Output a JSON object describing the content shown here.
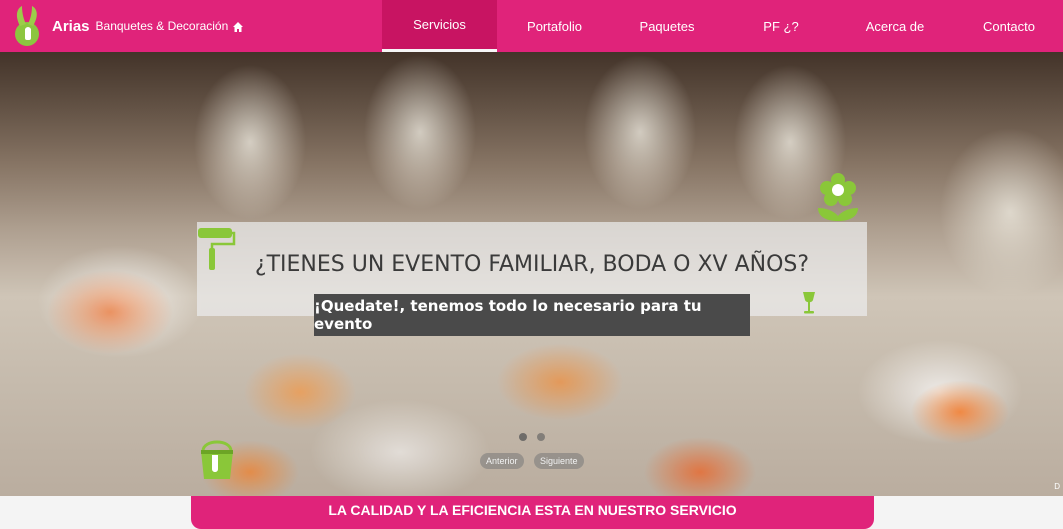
{
  "brand": {
    "name": "Arias",
    "tagline": "Banquetes & Decoración"
  },
  "nav": {
    "items": [
      {
        "label": "Servicios",
        "active": true
      },
      {
        "label": "Portafolio",
        "active": false
      },
      {
        "label": "Paquetes",
        "active": false
      },
      {
        "label": "PF ¿?",
        "active": false
      },
      {
        "label": "Acerca de",
        "active": false
      },
      {
        "label": "Contacto",
        "active": false
      }
    ]
  },
  "hero": {
    "title": "¿TIENES UN EVENTO FAMILIAR, BODA O XV AÑOS?",
    "subtitle": "¡Quedate!, tenemos todo lo necesario para tu evento",
    "prev_label": "Anterior",
    "next_label": "Siguiente",
    "corner_mark": "D",
    "slide_count": 2,
    "active_slide": 1
  },
  "banner": {
    "text": "LA CALIDAD Y LA EFICIENCIA ESTA EN NUESTRO SERVICIO"
  },
  "colors": {
    "brand_pink": "#e0237a",
    "active_tab": "#c81462",
    "icon_green": "#8cc63f"
  },
  "icons": [
    "logo-icon",
    "home-icon",
    "paint-roller-icon",
    "flower-icon",
    "wine-glass-icon",
    "paint-bucket-icon"
  ]
}
